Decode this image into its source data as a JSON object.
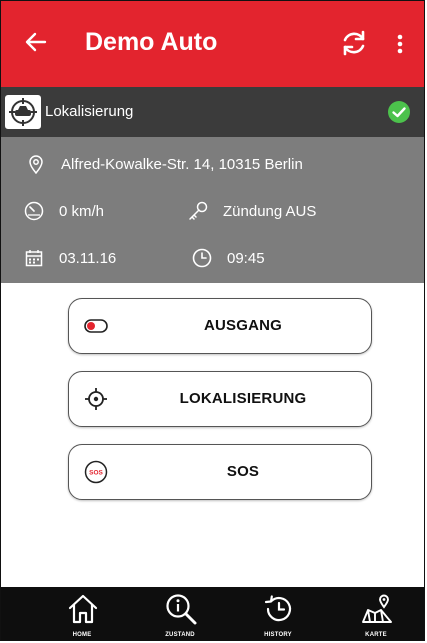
{
  "app_bar": {
    "title": "Demo Auto",
    "back_icon": "arrow-left-icon",
    "sync_icon": "sync-icon",
    "menu_icon": "more-vertical-icon",
    "color": "#e3242e"
  },
  "status": {
    "label": "Lokalisierung",
    "icon": "car-target-icon",
    "state_icon": "check-circle-icon",
    "state_color": "#4cc24c"
  },
  "info": {
    "address": "Alfred-Kowalke-Str. 14, 10315 Berlin",
    "speed": "0 km/h",
    "ignition": "Zündung AUS",
    "date": "03.11.16",
    "time": "09:45"
  },
  "actions": [
    {
      "label": "AUSGANG",
      "icon": "toggle-off-icon"
    },
    {
      "label": "LOKALISIERUNG",
      "icon": "locate-icon"
    },
    {
      "label": "SOS",
      "icon": "sos-icon"
    }
  ],
  "bottom_nav": [
    {
      "label": "HOME",
      "icon": "home-icon"
    },
    {
      "label": "ZUSTAND",
      "icon": "search-info-icon"
    },
    {
      "label": "HISTORY",
      "icon": "history-icon"
    },
    {
      "label": "KARTE",
      "icon": "map-icon"
    }
  ]
}
